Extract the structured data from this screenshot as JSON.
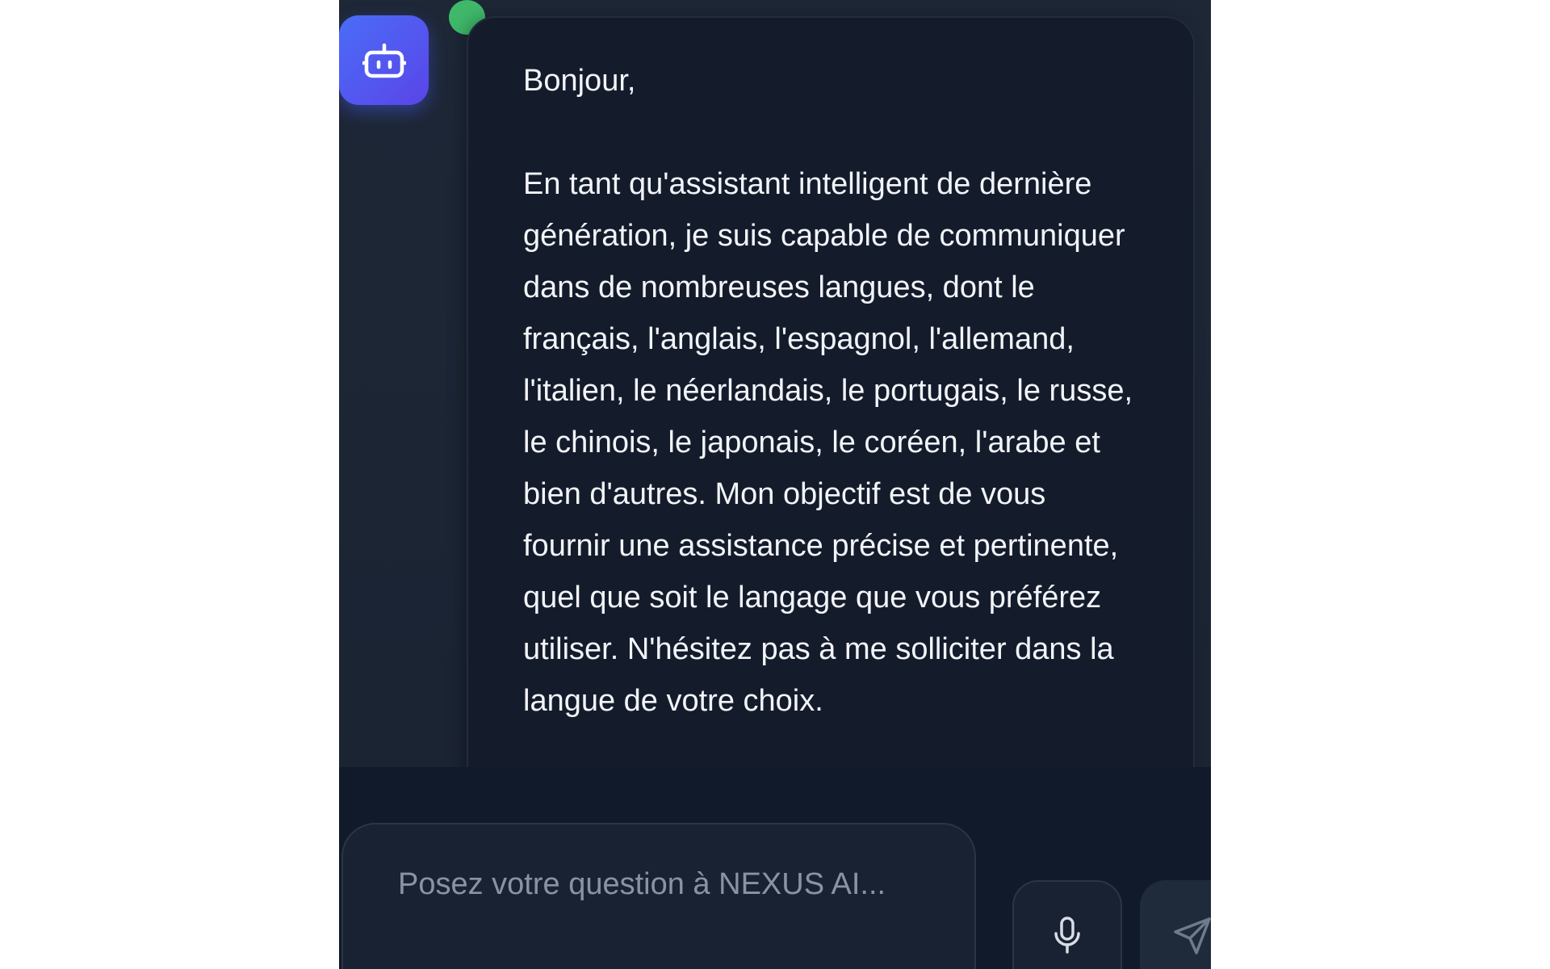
{
  "message": {
    "text": "Bonjour,\n\nEn tant qu'assistant intelligent de dernière génération, je suis capable de communiquer dans de nombreuses langues, dont le français, l'anglais, l'espagnol, l'allemand, l'italien, le néerlandais, le portugais, le russe, le chinois, le japonais, le coréen, l'arabe et bien d'autres. Mon objectif est de vous fournir une assistance précise et pertinente, quel que soit le langage que vous préférez utiliser. N'hésitez pas à me solliciter dans la langue de votre choix."
  },
  "composer": {
    "placeholder": "Posez votre question à NEXUS AI..."
  },
  "icons": {
    "avatar": "robot-icon",
    "mic": "microphone-icon",
    "send": "send-icon"
  },
  "colors": {
    "background": "#1a2332",
    "bubble": "#141c2c",
    "avatar_start": "#4a6cf7",
    "avatar_end": "#5a45e8",
    "online": "#3fb86a",
    "text": "#f2f4f8",
    "placeholder": "#8b93a3"
  }
}
